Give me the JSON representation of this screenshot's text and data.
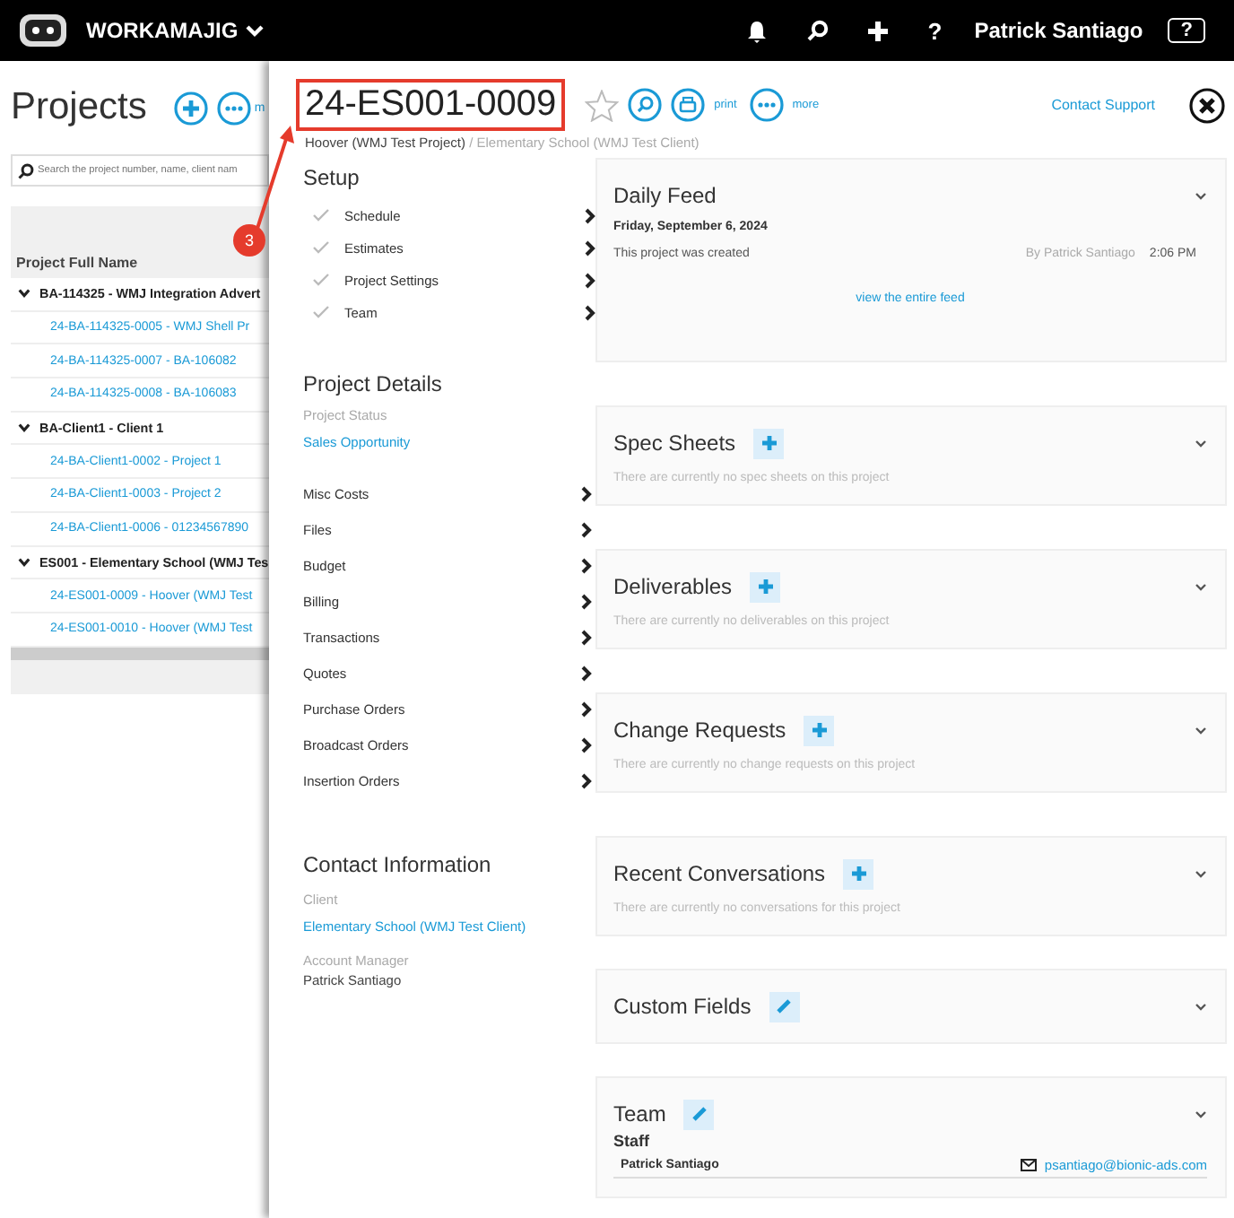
{
  "topbar": {
    "app_name": "WORKAMAJIG",
    "user": "Patrick Santiago",
    "help": "?"
  },
  "projects_list": {
    "title": "Projects",
    "more_label": "m",
    "search": {
      "placeholder": "Search the project number, name, client nam"
    },
    "column": "Project Full Name",
    "groups": [
      {
        "label": "BA-114325 - WMJ Integration Advert",
        "expanded": true,
        "children": [
          {
            "label": "24-BA-114325-0005 - WMJ Shell Pr"
          },
          {
            "label": "24-BA-114325-0007 - BA-106082"
          },
          {
            "label": "24-BA-114325-0008 - BA-106083"
          }
        ]
      },
      {
        "label": "BA-Client1 - Client 1",
        "expanded": true,
        "children": [
          {
            "label": "24-BA-Client1-0002 - Project 1"
          },
          {
            "label": "24-BA-Client1-0003 - Project 2"
          },
          {
            "label": "24-BA-Client1-0006 - 01234567890"
          }
        ]
      },
      {
        "label": "ES001 - Elementary School (WMJ Tes",
        "expanded": true,
        "children": [
          {
            "label": "24-ES001-0009 - Hoover (WMJ Test"
          },
          {
            "label": "24-ES001-0010 - Hoover (WMJ Test"
          }
        ]
      }
    ]
  },
  "project": {
    "title": "24-ES001-0009",
    "starred": false,
    "print_label": "print",
    "more_label": "more",
    "contact_support": "Contact Support",
    "breadcrumb": {
      "project": "Hoover (WMJ Test Project)",
      "client": "/ Elementary School (WMJ Test Client)"
    },
    "setup": {
      "heading": "Setup",
      "items": [
        {
          "label": "Schedule"
        },
        {
          "label": "Estimates"
        },
        {
          "label": "Project Settings"
        },
        {
          "label": "Team"
        }
      ]
    },
    "details": {
      "heading": "Project Details",
      "status_label": "Project Status",
      "status": "Sales Opportunity",
      "links": [
        {
          "label": "Misc Costs"
        },
        {
          "label": "Files"
        },
        {
          "label": "Budget"
        },
        {
          "label": "Billing"
        },
        {
          "label": "Transactions"
        },
        {
          "label": "Quotes"
        },
        {
          "label": "Purchase Orders"
        },
        {
          "label": "Broadcast Orders"
        },
        {
          "label": "Insertion Orders"
        }
      ]
    },
    "contact": {
      "heading": "Contact Information",
      "client_label": "Client",
      "client": "Elementary School (WMJ Test Client)",
      "manager_label": "Account Manager",
      "manager": "Patrick Santiago"
    },
    "cards": [
      {
        "kind": "feed",
        "title": "Daily Feed",
        "date": "Friday, September 6, 2024",
        "entry": "This project was created",
        "by": "By Patrick Santiago",
        "time": "2:06 PM",
        "link": "view the entire feed"
      },
      {
        "kind": "empty",
        "title": "Spec Sheets",
        "button": {
          "kind": "add"
        },
        "text": "There are currently no spec sheets on this project"
      },
      {
        "kind": "empty",
        "title": "Deliverables",
        "button": {
          "kind": "add"
        },
        "text": "There are currently no deliverables on this project"
      },
      {
        "kind": "empty",
        "title": "Change Requests",
        "button": {
          "kind": "add"
        },
        "text": "There are currently no change requests on this project"
      },
      {
        "kind": "empty",
        "title": "Recent Conversations",
        "button": {
          "kind": "add"
        },
        "text": "There are currently no conversations for this project"
      },
      {
        "kind": "plain",
        "title": "Custom Fields",
        "button": {
          "kind": "edit"
        }
      },
      {
        "kind": "team",
        "title": "Team",
        "button": {
          "kind": "edit"
        },
        "subheading": "Staff",
        "member": "Patrick Santiago",
        "email": "psantiago@bionic-ads.com"
      }
    ]
  },
  "annotation": {
    "number": "3"
  }
}
